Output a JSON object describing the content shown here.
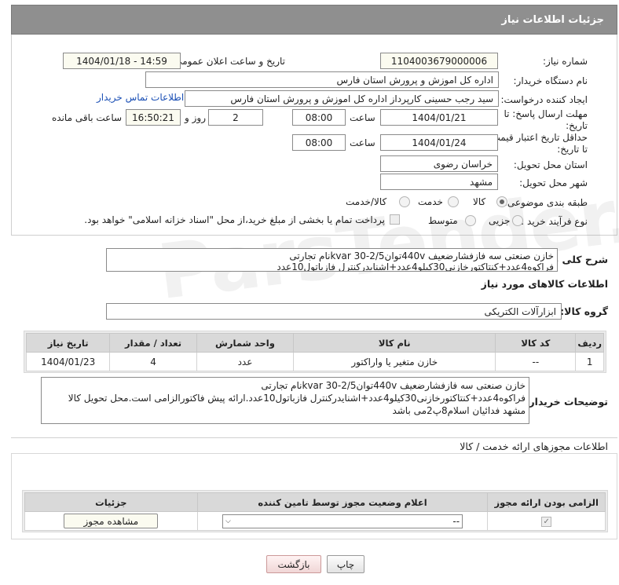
{
  "header": {
    "title": "جزئیات اطلاعات نیاز"
  },
  "fields": {
    "need_number_label": "شماره نیاز:",
    "need_number": "1104003679000006",
    "announce_label": "تاریخ و ساعت اعلان عمومی:",
    "announce_value": "1404/01/18 - 14:59",
    "buyer_org_label": "نام دستگاه خریدار:",
    "buyer_org": "اداره کل اموزش و پرورش استان فارس",
    "requester_label": "ایجاد کننده درخواست:",
    "requester": "سید رجب حسینی کارپرداز اداره کل اموزش و پرورش استان فارس",
    "contact_link": "اطلاعات تماس خریدار",
    "send_deadline_label": "مهلت ارسال پاسخ: تا تاریخ:",
    "send_date": "1404/01/21",
    "time_label": "ساعت",
    "send_time": "08:00",
    "days_value": "2",
    "days_label": "روز و",
    "remaining_time": "16:50:21",
    "remaining_label": "ساعت باقی مانده",
    "price_validity_label": "حداقل تاریخ اعتبار قیمت: تا تاریخ:",
    "price_date": "1404/01/24",
    "price_time": "08:00",
    "province_label": "استان محل تحویل:",
    "province": "خراسان رضوی",
    "city_label": "شهر محل تحویل:",
    "city": "مشهد",
    "category_label": "طبقه بندی موضوعی:",
    "category_options": [
      "کالا",
      "خدمت",
      "کالا/خدمت"
    ],
    "process_label": "نوع فرآیند خرید :",
    "process_options": [
      "جزیی",
      "متوسط"
    ],
    "payment_note": "پرداخت تمام یا بخشی از مبلغ خرید،از محل \"اسناد خزانه اسلامی\" خواهد بود."
  },
  "general_desc": {
    "label": "شرح کلی نیاز:",
    "text": "خازن صنعتی سه فازفشارضعیف 440vتوانkvar 30-2/5نام تجارتی فراکوه4عدد+کنتاکتورخازنی30کیلو4عدد+اشنایدرکنترل فازباتول10عدد"
  },
  "goods": {
    "section_title": "اطلاعات کالاهای مورد نیاز",
    "group_label": "گروه کالا:",
    "group_value": "ابزارآلات الکتریکی",
    "columns": [
      "ردیف",
      "کد کالا",
      "نام کالا",
      "واحد شمارش",
      "تعداد / مقدار",
      "تاریخ نیاز"
    ],
    "rows": [
      {
        "row": "1",
        "code": "--",
        "name": "خازن متغیر یا واراکتور",
        "unit": "عدد",
        "qty": "4",
        "date": "1404/01/23"
      }
    ]
  },
  "buyer_notes": {
    "label": "توضیحات خریدار:",
    "text": "خازن صنعتی سه فازفشارضعیف 440vتوانkvar 30-2/5نام تجارتی فراکوه4عدد+کنتاکتورخازنی30کیلو4عدد+اشنایدرکنترل فازباتول10عدد.ارائه پیش فاکتورالزامی است.محل تحویل کالا مشهد فدائیان اسلام8پ2می باشد"
  },
  "permits": {
    "section_title": "اطلاعات مجوزهای ارائه خدمت / کالا",
    "columns": [
      "الزامی بودن ارائه مجوز",
      "اعلام وضعیت مجوز توسط تامین کننده",
      "جزئیات"
    ],
    "select_value": "--",
    "view_button": "مشاهده مجوز"
  },
  "footer": {
    "print_button": "چاپ",
    "back_button": "بازگشت"
  },
  "watermark": "ParsTender.net"
}
